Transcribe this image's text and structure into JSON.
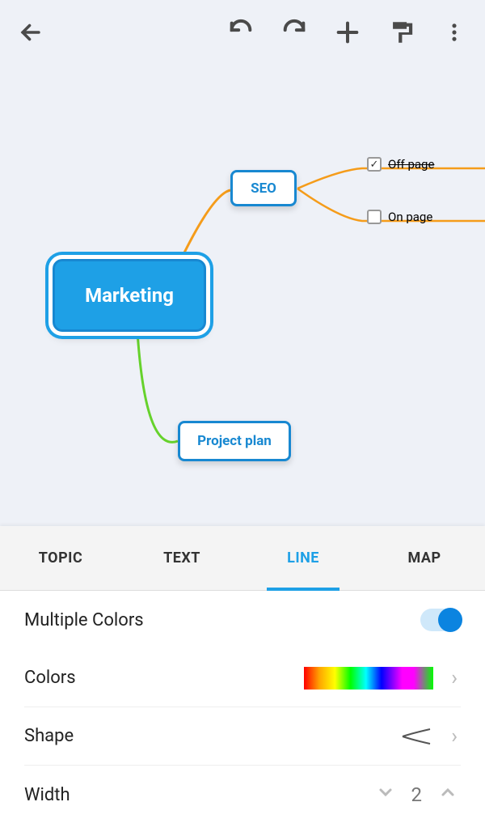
{
  "toolbar": {
    "icons": {
      "back": "back-arrow",
      "undo": "undo",
      "redo": "redo",
      "add": "plus",
      "style": "format",
      "menu": "more-vertical"
    }
  },
  "mindmap": {
    "root": {
      "label": "Marketing"
    },
    "seo": {
      "label": "SEO"
    },
    "project_plan": {
      "label": "Project plan"
    },
    "offpage": {
      "label": "Off page",
      "checked": true
    },
    "onpage": {
      "label": "On page",
      "checked": false
    }
  },
  "panel": {
    "tabs": [
      {
        "key": "topic",
        "label": "TOPIC"
      },
      {
        "key": "text",
        "label": "TEXT"
      },
      {
        "key": "line",
        "label": "LINE"
      },
      {
        "key": "map",
        "label": "MAP"
      }
    ],
    "active_tab": "line",
    "multiple_colors_label": "Multiple Colors",
    "multiple_colors_on": true,
    "colors_label": "Colors",
    "shape_label": "Shape",
    "width_label": "Width",
    "width_value": "2"
  }
}
